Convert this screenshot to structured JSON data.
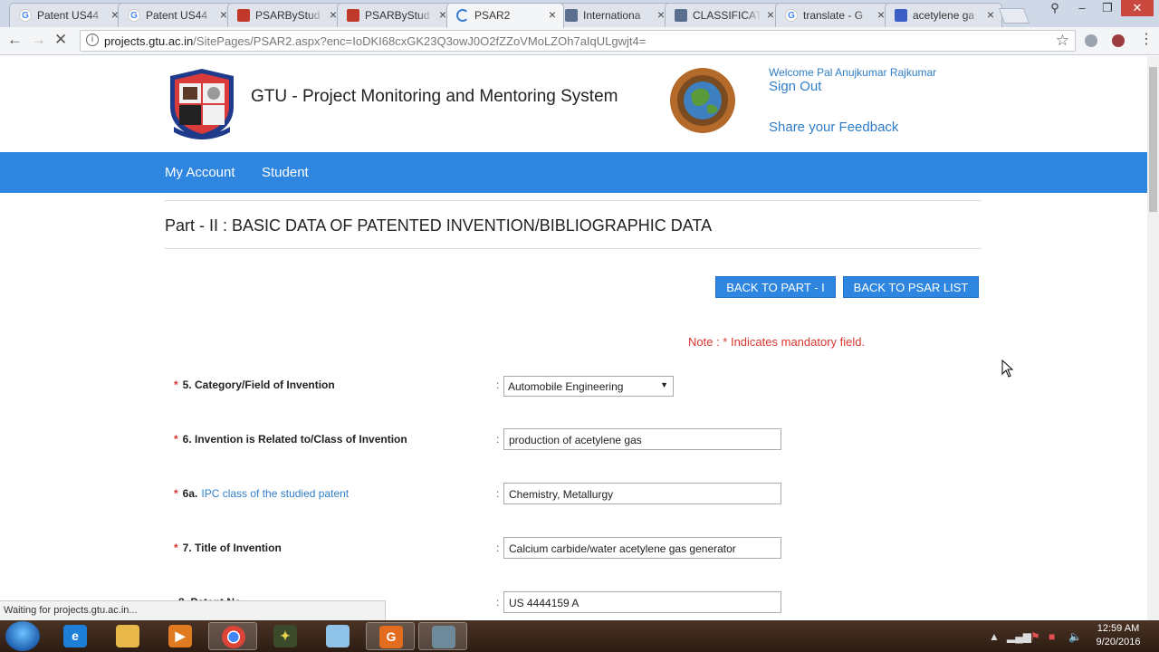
{
  "browser": {
    "tabs": [
      {
        "label": "Patent US44",
        "icon": "google-icon",
        "active": false
      },
      {
        "label": "Patent US44",
        "icon": "google-icon",
        "active": false
      },
      {
        "label": "PSARByStud",
        "icon": "pdf-icon",
        "active": false
      },
      {
        "label": "PSARByStud",
        "icon": "pdf-icon",
        "active": false
      },
      {
        "label": "PSAR2",
        "icon": "loading-spinner-icon",
        "active": true
      },
      {
        "label": "Internationa",
        "icon": "document-icon",
        "active": false
      },
      {
        "label": "CLASSIFICAT",
        "icon": "document-icon",
        "active": false
      },
      {
        "label": "translate - G",
        "icon": "google-icon",
        "active": false
      },
      {
        "label": "acetylene ga",
        "icon": "web-icon",
        "active": false
      }
    ],
    "url_host": "projects.gtu.ac.in",
    "url_path": "/SitePages/PSAR2.aspx?enc=IoDKI68cxGK23Q3owJ0O2fZZoVMoLZOh7aIqULgwjt4=",
    "status_text": "Waiting for projects.gtu.ac.in..."
  },
  "header": {
    "site_title": "GTU - Project Monitoring and Mentoring System",
    "welcome": "Welcome Pal Anujkumar Rajkumar",
    "sign_out": "Sign Out",
    "feedback": "Share your Feedback"
  },
  "nav": {
    "items": [
      "My Account",
      "Student"
    ]
  },
  "main": {
    "part_title": "Part - II : BASIC DATA OF PATENTED INVENTION/BIBLIOGRAPHIC DATA",
    "back_part1": "BACK TO PART - I",
    "back_psar_list": "BACK TO PSAR LIST",
    "note": "Note : * Indicates mandatory field.",
    "fields": [
      {
        "marker": "*",
        "label": "5. Category/Field of Invention",
        "link": "",
        "value": "Automobile Engineering",
        "type": "select"
      },
      {
        "marker": "*",
        "label": "6. Invention is Related to/Class of Invention",
        "link": "",
        "value": "production of acetylene gas",
        "type": "text"
      },
      {
        "marker": "*",
        "label": "6a.",
        "link": "IPC class of the studied patent",
        "value": "Chemistry, Metallurgy",
        "type": "text"
      },
      {
        "marker": "*",
        "label": "7. Title of Invention",
        "link": "",
        "value": "Calcium carbide/water acetylene gas generator",
        "type": "text"
      },
      {
        "marker": "",
        "label": "8. Patent No.",
        "link": "",
        "value": "US 4444159 A",
        "type": "text"
      }
    ]
  },
  "taskbar": {
    "time": "12:59 AM",
    "date": "9/20/2016",
    "apps": [
      "internet-explorer",
      "file-explorer",
      "media-player",
      "chrome",
      "app",
      "app",
      "pdf-app",
      "app"
    ]
  },
  "colors": {
    "nav_blue": "#2e86e0",
    "link_blue": "#2f7dc8",
    "required_red": "#d9362f"
  }
}
